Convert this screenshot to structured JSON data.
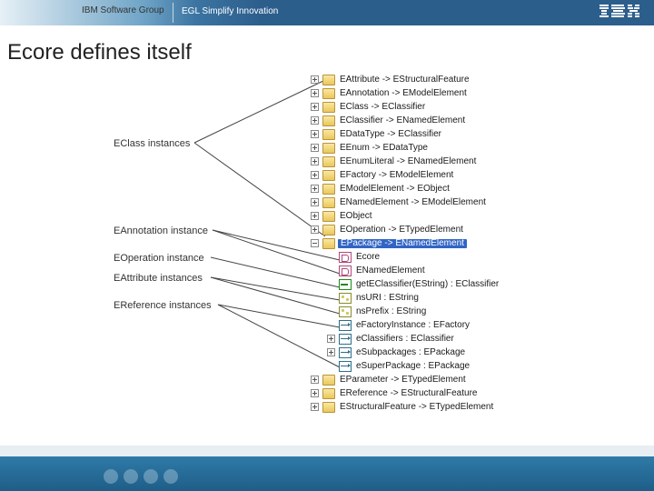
{
  "header": {
    "group": "IBM Software Group",
    "tagline": "EGL Simplify Innovation",
    "logo_alt": "IBM"
  },
  "title": "Ecore defines itself",
  "labels": {
    "eclass": "EClass instances",
    "eann": "EAnnotation instance",
    "eop": "EOperation instance",
    "eattr": "EAttribute instances",
    "eref": "EReference instances"
  },
  "tree": {
    "top": [
      {
        "exp": "plus",
        "icon": "class",
        "text": "EAttribute -> EStructuralFeature"
      },
      {
        "exp": "plus",
        "icon": "class",
        "text": "EAnnotation -> EModelElement"
      },
      {
        "exp": "plus",
        "icon": "class",
        "text": "EClass -> EClassifier"
      },
      {
        "exp": "plus",
        "icon": "class",
        "text": "EClassifier -> ENamedElement"
      },
      {
        "exp": "plus",
        "icon": "class",
        "text": "EDataType -> EClassifier"
      },
      {
        "exp": "plus",
        "icon": "class",
        "text": "EEnum -> EDataType"
      },
      {
        "exp": "plus",
        "icon": "class",
        "text": "EEnumLiteral -> ENamedElement"
      },
      {
        "exp": "plus",
        "icon": "class",
        "text": "EFactory -> EModelElement"
      },
      {
        "exp": "plus",
        "icon": "class",
        "text": "EModelElement -> EObject"
      },
      {
        "exp": "plus",
        "icon": "class",
        "text": "ENamedElement -> EModelElement"
      },
      {
        "exp": "plus",
        "icon": "class",
        "text": "EObject"
      },
      {
        "exp": "plus",
        "icon": "class",
        "text": "EOperation -> ETypedElement"
      }
    ],
    "selected": {
      "exp": "minus",
      "icon": "class",
      "text": "EPackage -> ENamedElement"
    },
    "children": [
      {
        "exp": "none",
        "indent": 1,
        "icon": "ann",
        "text": "Ecore"
      },
      {
        "exp": "none",
        "indent": 1,
        "icon": "ann",
        "text": "ENamedElement"
      },
      {
        "exp": "none",
        "indent": 1,
        "icon": "op",
        "text": "getEClassifier(EString) : EClassifier"
      },
      {
        "exp": "none",
        "indent": 1,
        "icon": "attr",
        "text": "nsURI : EString"
      },
      {
        "exp": "none",
        "indent": 1,
        "icon": "attr",
        "text": "nsPrefix : EString"
      },
      {
        "exp": "none",
        "indent": 1,
        "icon": "ref",
        "text": "eFactoryInstance : EFactory"
      },
      {
        "exp": "plus",
        "indent": 1,
        "icon": "ref",
        "text": "eClassifiers : EClassifier"
      },
      {
        "exp": "plus",
        "indent": 1,
        "icon": "ref",
        "text": "eSubpackages : EPackage"
      },
      {
        "exp": "none",
        "indent": 1,
        "icon": "ref",
        "text": "eSuperPackage : EPackage"
      }
    ],
    "bottom": [
      {
        "exp": "plus",
        "icon": "class",
        "text": "EParameter -> ETypedElement"
      },
      {
        "exp": "plus",
        "icon": "class",
        "text": "EReference -> EStructuralFeature"
      },
      {
        "exp": "plus",
        "icon": "class",
        "text": "EStructuralFeature -> ETypedElement"
      }
    ]
  }
}
